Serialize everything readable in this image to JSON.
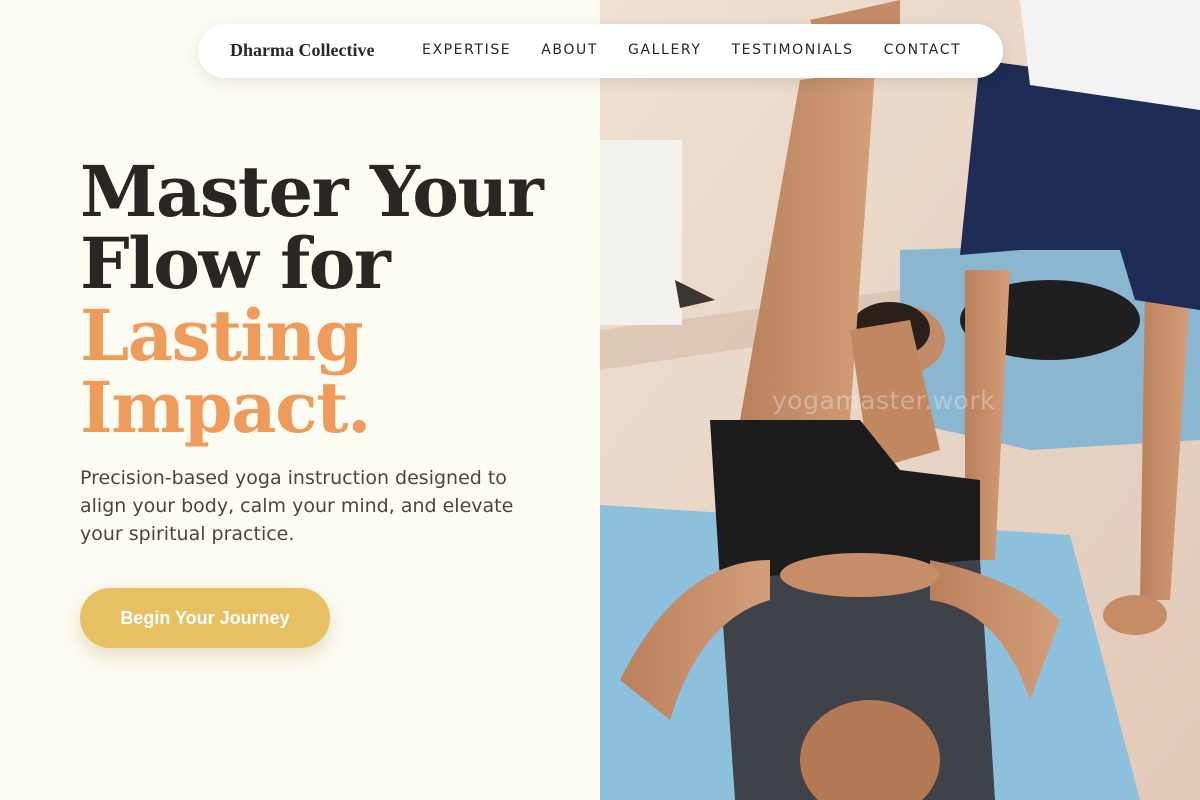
{
  "nav": {
    "brand": "Dharma Collective",
    "items": [
      {
        "label": "EXPERTISE"
      },
      {
        "label": "ABOUT"
      },
      {
        "label": "GALLERY"
      },
      {
        "label": "TESTIMONIALS"
      },
      {
        "label": "CONTACT"
      }
    ]
  },
  "hero": {
    "headline_lines": [
      "Master Your",
      "Flow for"
    ],
    "headline_accent_lines": [
      "Lasting",
      "Impact."
    ],
    "subtext": "Precision-based yoga instruction designed to align your body, calm your mind, and elevate your spiritual practice.",
    "cta_label": "Begin Your Journey"
  },
  "photo": {
    "watermark": "yogamaster.work"
  },
  "colors": {
    "background": "#fdfcf3",
    "text": "#2a2623",
    "accent": "#ee9c5c",
    "cta": "#e6c062"
  }
}
